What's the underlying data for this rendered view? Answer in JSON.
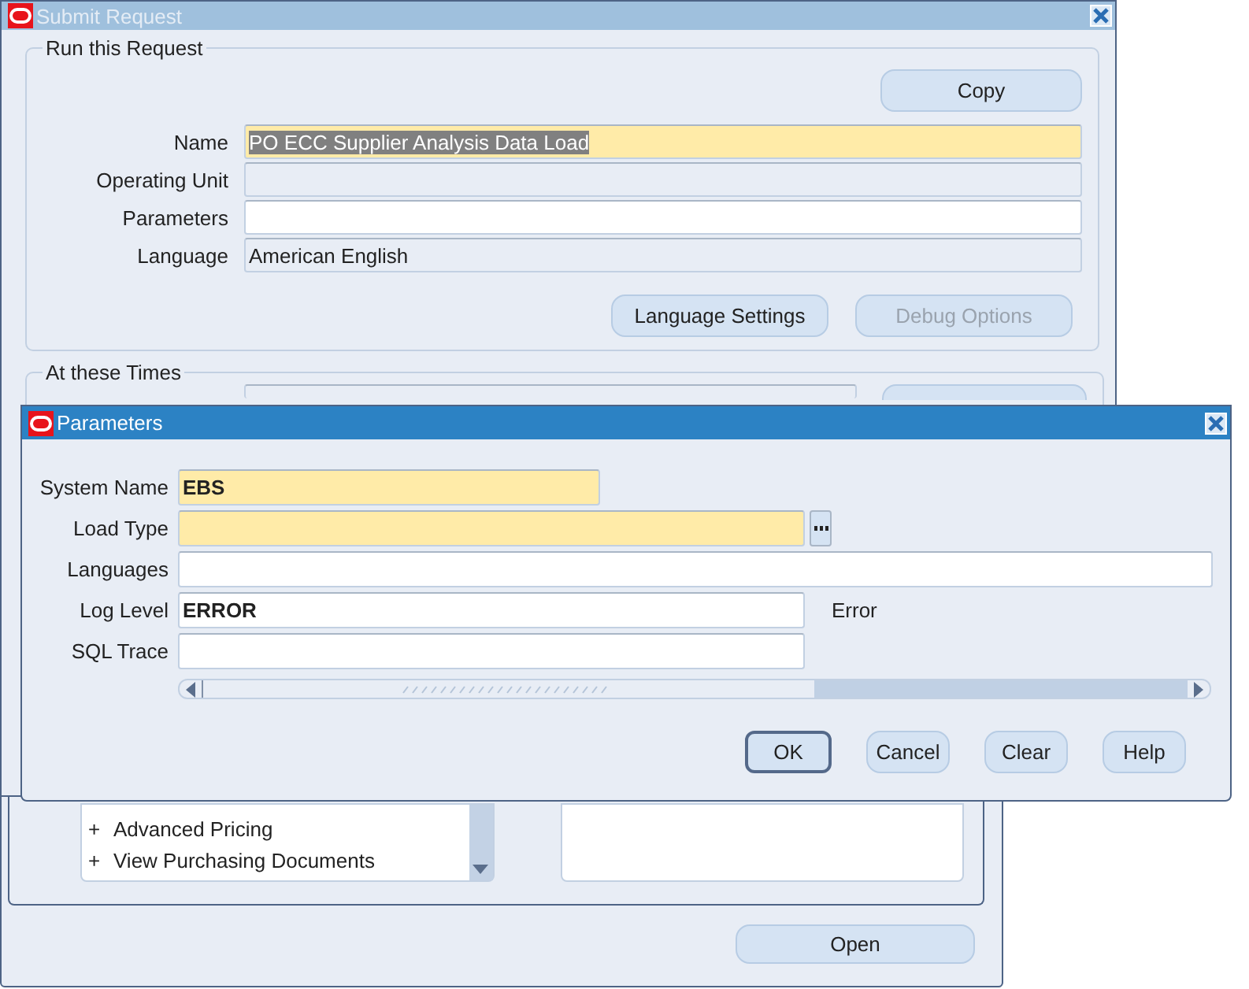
{
  "navigator_window": {
    "list_items": [
      {
        "marker": "+",
        "label": "Advanced Pricing"
      },
      {
        "marker": "+",
        "label": "View Purchasing Documents"
      }
    ],
    "open_button": "Open"
  },
  "submit_request": {
    "title": "Submit Request",
    "active": false,
    "run_section": {
      "title": "Run this Request",
      "copy_button": "Copy",
      "fields": [
        {
          "label": "Name",
          "kind": "required",
          "value": "PO ECC Supplier Analysis Data Load",
          "text_selected": true
        },
        {
          "label": "Operating Unit",
          "kind": "readonly"
        },
        {
          "label": "Parameters",
          "kind": "normal"
        },
        {
          "label": "Language",
          "kind": "readonly",
          "value": "American English"
        }
      ],
      "buttons": [
        {
          "label": "Language Settings",
          "disabled": false
        },
        {
          "label": "Debug Options",
          "disabled": true
        }
      ]
    },
    "times_section": {
      "title": "At these Times"
    }
  },
  "parameters_dialog": {
    "title": "Parameters",
    "active": true,
    "fields": [
      {
        "label": "System Name",
        "kind": "required",
        "value": "EBS"
      },
      {
        "label": "Load Type",
        "kind": "required",
        "has_lov": true
      },
      {
        "label": "Languages",
        "kind": "normal"
      },
      {
        "label": "Log Level",
        "kind": "normal",
        "value": "ERROR",
        "description": "Error"
      },
      {
        "label": "SQL Trace",
        "kind": "normal"
      }
    ],
    "buttons": [
      {
        "label": "OK",
        "default": true
      },
      {
        "label": "Cancel",
        "default": false
      },
      {
        "label": "Clear",
        "default": false
      },
      {
        "label": "Help",
        "default": false
      }
    ]
  }
}
